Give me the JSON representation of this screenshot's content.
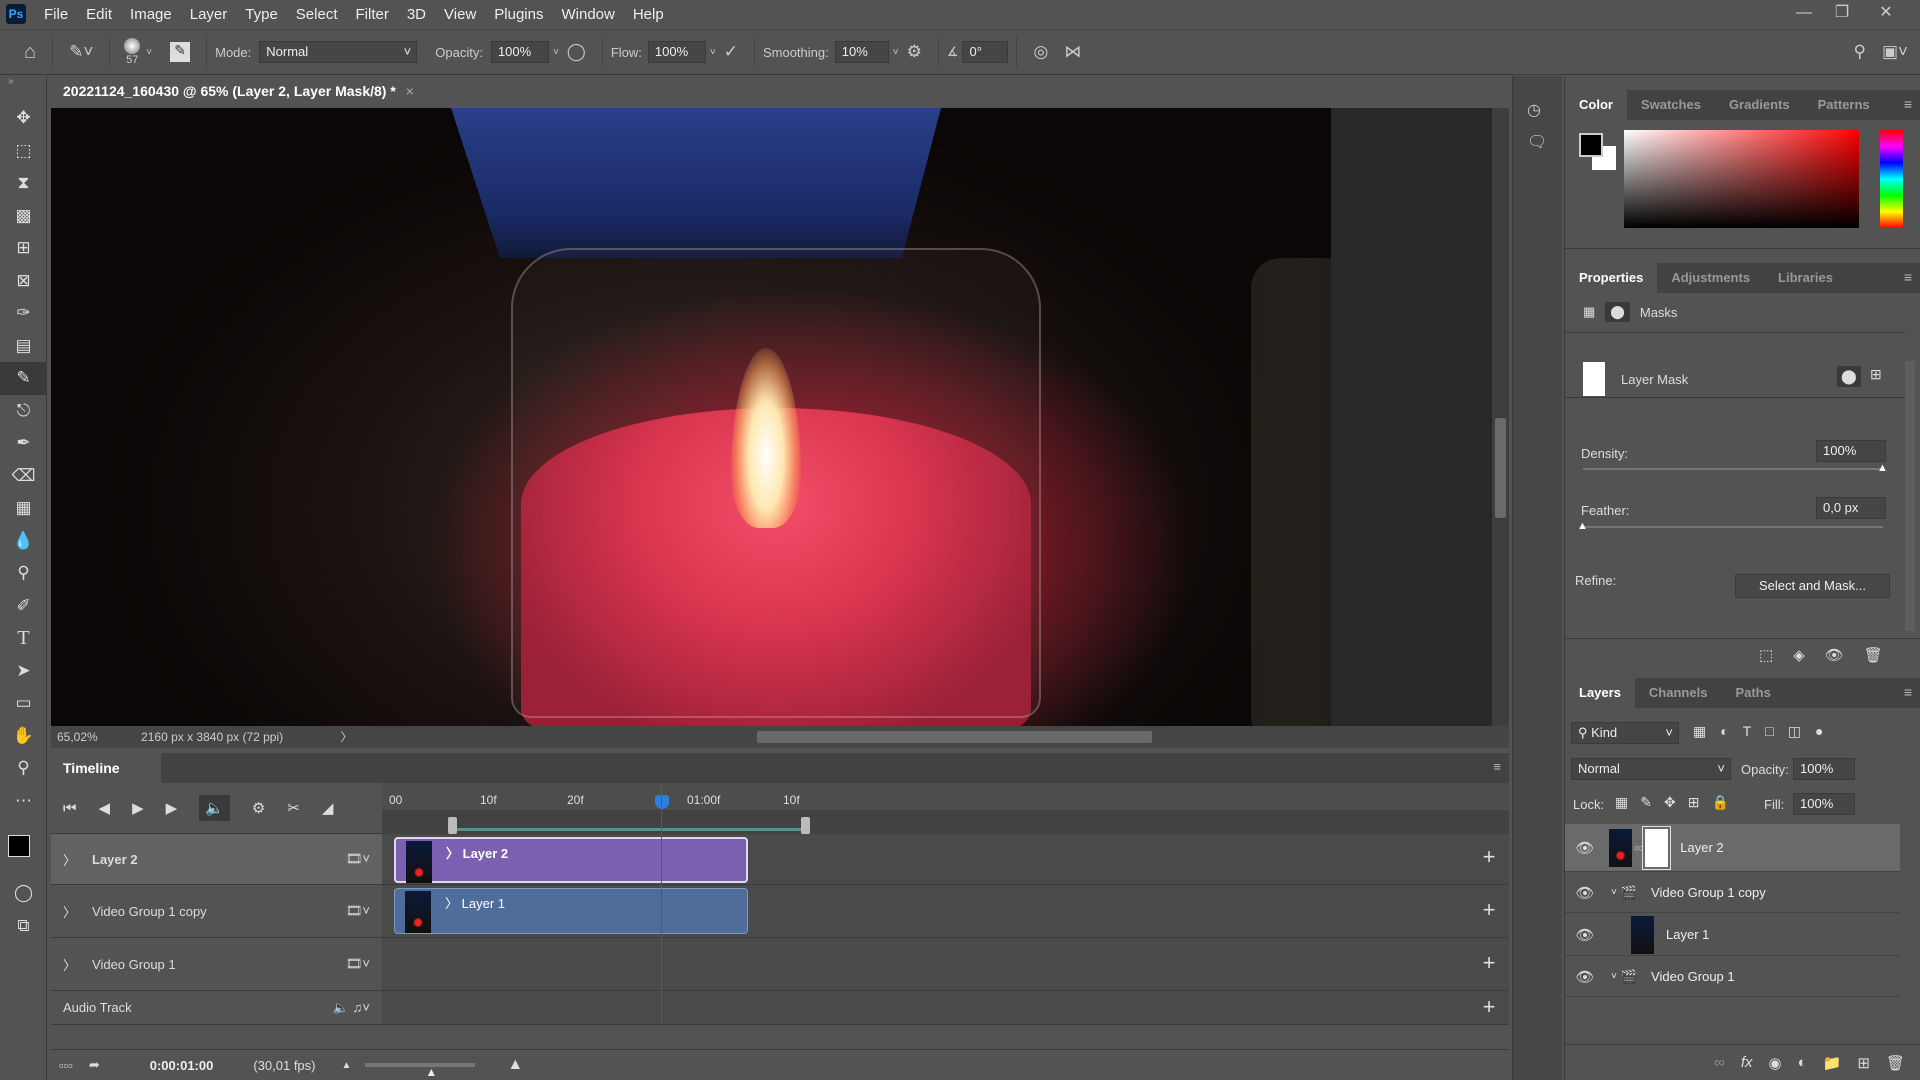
{
  "app": {
    "logo": "Ps",
    "menu": [
      "File",
      "Edit",
      "Image",
      "Layer",
      "Type",
      "Select",
      "Filter",
      "3D",
      "View",
      "Plugins",
      "Window",
      "Help"
    ]
  },
  "options": {
    "brush_size": "57",
    "mode_label": "Mode:",
    "mode": "Normal",
    "opacity_label": "Opacity:",
    "opacity": "100%",
    "flow_label": "Flow:",
    "flow": "100%",
    "smoothing_label": "Smoothing:",
    "smoothing": "10%",
    "angle": "0°"
  },
  "document": {
    "tab_title": "20221124_160430 @ 65% (Layer 2, Layer Mask/8) *",
    "zoom": "65,02%",
    "info": "2160 px x 3840 px (72 ppi)"
  },
  "timeline": {
    "title": "Timeline",
    "ruler": [
      "00",
      "10f",
      "20f",
      "01:00f",
      "10f"
    ],
    "tracks": [
      {
        "name": "Layer 2",
        "clip": "Layer 2",
        "clip_color": "#7b5fb0"
      },
      {
        "name": "Video Group 1 copy",
        "clip": "Layer 1",
        "clip_color": "#4f6d9a"
      },
      {
        "name": "Video Group 1"
      }
    ],
    "audio_track": "Audio Track",
    "timecode": "0:00:01:00",
    "fps": "(30,01 fps)"
  },
  "color_panel": {
    "tabs": [
      "Color",
      "Swatches",
      "Gradients",
      "Patterns"
    ],
    "hue": "#ff0000"
  },
  "properties": {
    "tabs": [
      "Properties",
      "Adjustments",
      "Libraries"
    ],
    "section": "Masks",
    "mask_name": "Layer Mask",
    "density_label": "Density:",
    "density": "100%",
    "density_value": 100,
    "feather_label": "Feather:",
    "feather": "0,0 px",
    "refine_label": "Refine:",
    "select_mask_button": "Select and Mask..."
  },
  "layers": {
    "tabs": [
      "Layers",
      "Channels",
      "Paths"
    ],
    "filter": "Kind",
    "blend": "Normal",
    "opacity_label": "Opacity:",
    "opacity": "100%",
    "lock_label": "Lock:",
    "fill_label": "Fill:",
    "fill": "100%",
    "items": [
      {
        "name": "Layer 2",
        "selected": true
      },
      {
        "name": "Video Group 1 copy"
      },
      {
        "name": "Layer 1"
      },
      {
        "name": "Video Group 1"
      }
    ]
  }
}
